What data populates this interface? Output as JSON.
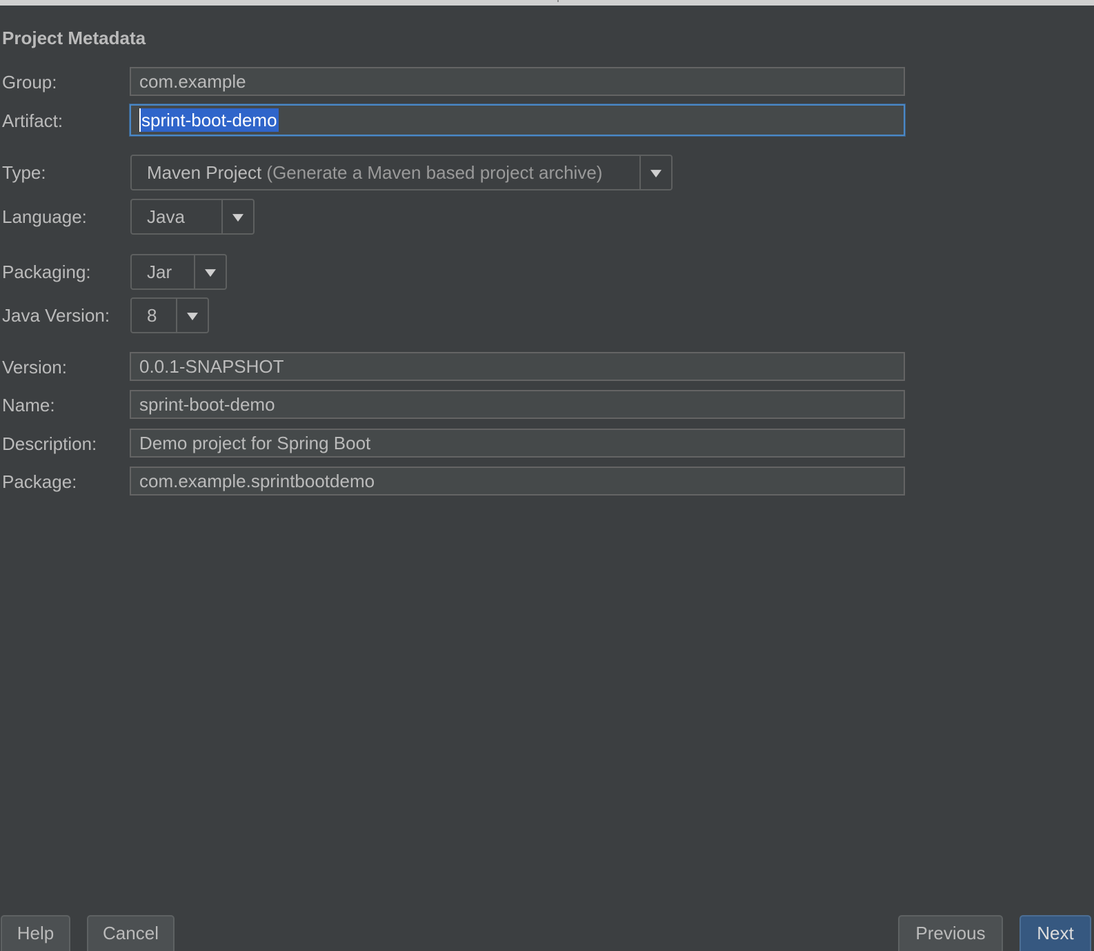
{
  "section": {
    "title": "Project Metadata"
  },
  "fields": {
    "group": {
      "label": "Group:",
      "value": "com.example"
    },
    "artifact": {
      "label": "Artifact:",
      "value": "sprint-boot-demo"
    },
    "type": {
      "label": "Type:",
      "value": "Maven Project",
      "hint": "(Generate a Maven based project archive)"
    },
    "language": {
      "label": "Language:",
      "value": "Java"
    },
    "packaging": {
      "label": "Packaging:",
      "value": "Jar"
    },
    "java_version": {
      "label": "Java Version:",
      "value": "8"
    },
    "version": {
      "label": "Version:",
      "value": "0.0.1-SNAPSHOT"
    },
    "name": {
      "label": "Name:",
      "value": "sprint-boot-demo"
    },
    "description": {
      "label": "Description:",
      "value": "Demo project for Spring Boot"
    },
    "package": {
      "label": "Package:",
      "value": "com.example.sprintbootdemo"
    }
  },
  "buttons": {
    "help": "Help",
    "cancel": "Cancel",
    "previous": "Previous",
    "next": "Next"
  },
  "colors": {
    "background": "#3c3f41",
    "field_bg": "#45494a",
    "focus_border": "#4a88c7",
    "selection": "#2f65ca",
    "default_button": "#365880"
  },
  "icons": {
    "dropdown": "triangle-down"
  }
}
